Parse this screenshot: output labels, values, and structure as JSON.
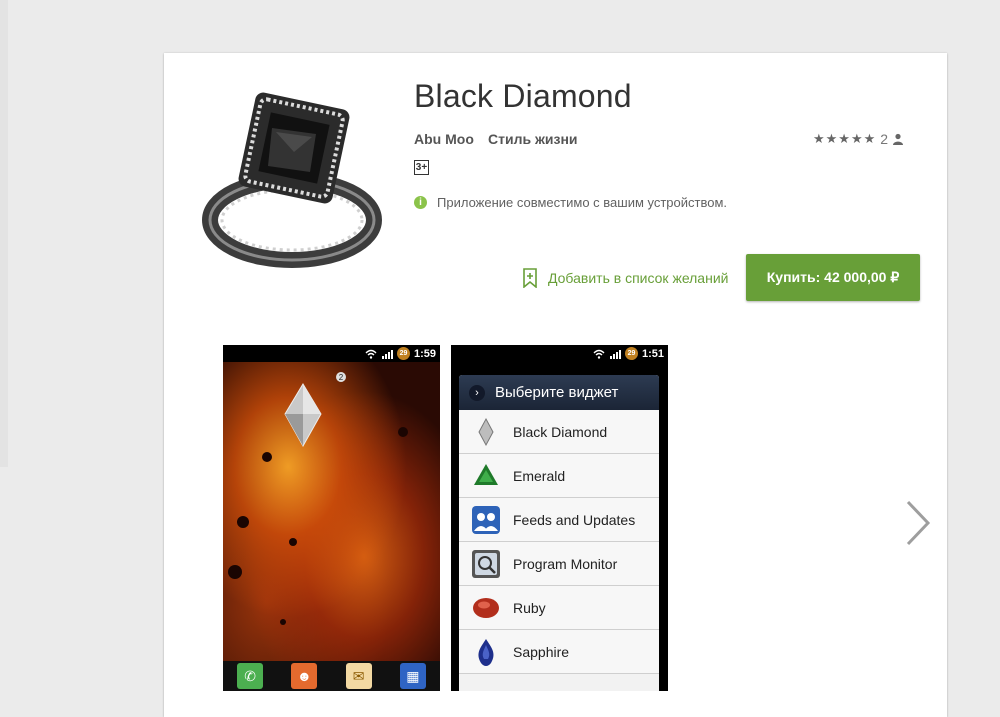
{
  "app": {
    "title": "Black Diamond",
    "developer": "Abu Moo",
    "category": "Стиль жизни",
    "rating_stars": "★★★★★",
    "rating_count": "2",
    "age_rating": "3+",
    "compat_text": "Приложение совместимо с вашим устройством.",
    "wishlist_label": "Добавить в список желаний",
    "buy_label": "Купить: 42 000,00 ₽"
  },
  "screenshots": [
    {
      "status_time": "1:59",
      "status_badge": "29",
      "notification_count": "2",
      "dock": [
        "phone-icon",
        "contacts-icon",
        "mail-icon",
        "apps-grid-icon"
      ]
    },
    {
      "status_time": "1:51",
      "status_badge": "29",
      "header": "Выберите виджет",
      "widgets": [
        {
          "label": "Black Diamond",
          "icon": "diamond-icon"
        },
        {
          "label": "Emerald",
          "icon": "emerald-icon"
        },
        {
          "label": "Feeds and Updates",
          "icon": "people-icon"
        },
        {
          "label": "Program Monitor",
          "icon": "monitor-icon"
        },
        {
          "label": "Ruby",
          "icon": "ruby-icon"
        },
        {
          "label": "Sapphire",
          "icon": "sapphire-icon"
        }
      ]
    }
  ],
  "colors": {
    "accent_green": "#689f38",
    "info_green": "#8bc34a"
  }
}
